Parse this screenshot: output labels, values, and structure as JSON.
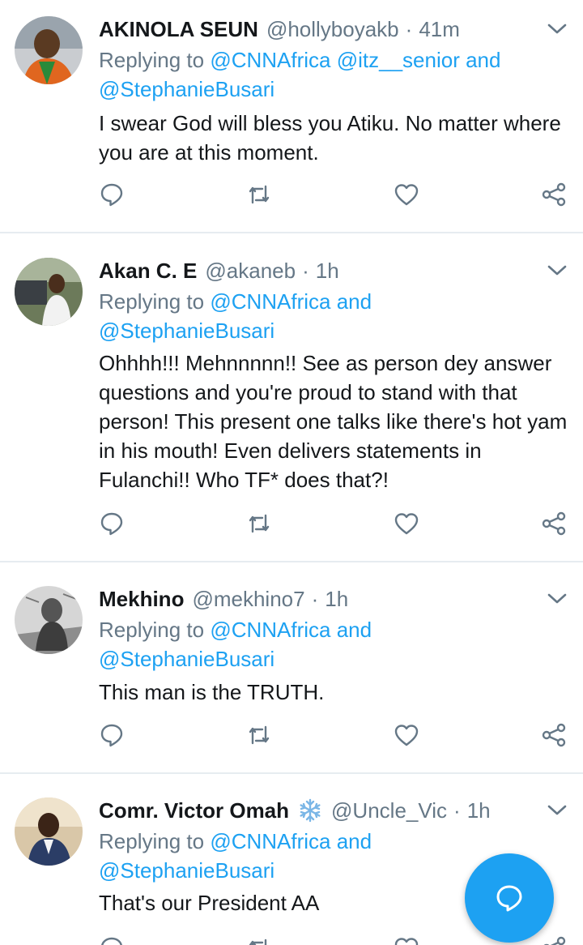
{
  "accent_color": "#1da1f2",
  "tweets": [
    {
      "name": "AKINOLA SEUN",
      "handle": "@hollyboyakb",
      "time": "41m",
      "replying_prefix": "Replying to",
      "mentions_line1": "@CNNAfrica @itz__senior and",
      "mentions_line2": "@StephanieBusari",
      "text": "I swear God will bless you Atiku. No matter where you are at this moment."
    },
    {
      "name": "Akan C. E",
      "handle": "@akaneb",
      "time": "1h",
      "replying_prefix": "Replying to",
      "mentions_line1": "@CNNAfrica and",
      "mentions_line2": "@StephanieBusari",
      "text": "Ohhhh!!! Mehnnnnn!! See as person dey answer questions and you're proud to stand with that person! This present one talks like there's hot yam in his mouth! Even delivers statements in Fulanchi!! Who TF* does that?!"
    },
    {
      "name": "Mekhino",
      "handle": "@mekhino7",
      "time": "1h",
      "replying_prefix": "Replying to",
      "mentions_line1": "@CNNAfrica and",
      "mentions_line2": "@StephanieBusari",
      "text": "This man is the TRUTH."
    },
    {
      "name": "Comr. Victor Omah",
      "badge_icon": "snowflake-icon",
      "handle": "@Uncle_Vic",
      "time": "1h",
      "replying_prefix": "Replying to",
      "mentions_line1": "@CNNAfrica and",
      "mentions_line2": "@StephanieBusari",
      "text": "That's our President AA"
    }
  ],
  "action_icons": [
    "reply-icon",
    "retweet-icon",
    "like-icon",
    "share-icon"
  ],
  "compose_icon": "compose-reply-icon"
}
